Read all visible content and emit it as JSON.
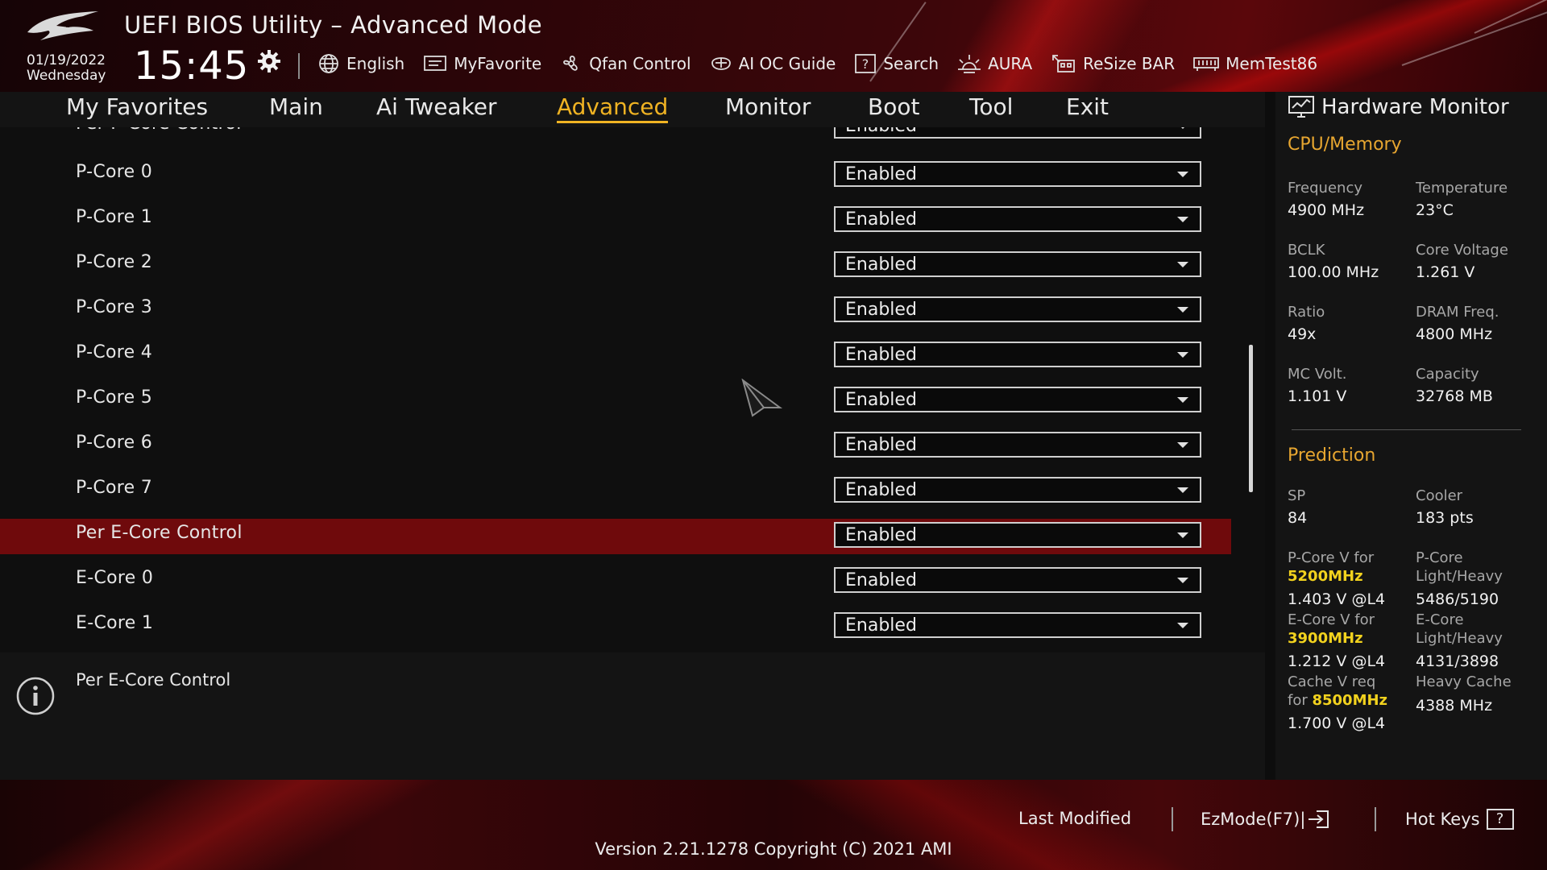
{
  "header": {
    "title": "UEFI BIOS Utility – Advanced Mode",
    "date": "01/19/2022",
    "weekday": "Wednesday",
    "time": "15:45",
    "toolbar": [
      {
        "label": "English",
        "icon": "globe-icon"
      },
      {
        "label": "MyFavorite",
        "icon": "favorite-icon"
      },
      {
        "label": "Qfan Control",
        "icon": "fan-icon"
      },
      {
        "label": "AI OC Guide",
        "icon": "ai-oc-icon"
      },
      {
        "label": "Search",
        "icon": "search-icon"
      },
      {
        "label": "AURA",
        "icon": "aura-icon"
      },
      {
        "label": "ReSize BAR",
        "icon": "resize-bar-icon"
      },
      {
        "label": "MemTest86",
        "icon": "memtest-icon"
      }
    ]
  },
  "tabs": [
    {
      "label": "My Favorites",
      "active": false
    },
    {
      "label": "Main",
      "active": false
    },
    {
      "label": "Ai Tweaker",
      "active": false
    },
    {
      "label": "Advanced",
      "active": true
    },
    {
      "label": "Monitor",
      "active": false
    },
    {
      "label": "Boot",
      "active": false
    },
    {
      "label": "Tool",
      "active": false
    },
    {
      "label": "Exit",
      "active": false
    }
  ],
  "settings": [
    {
      "label": "Per P-Core Control",
      "value": "Enabled",
      "selected": false
    },
    {
      "label": "P-Core 0",
      "value": "Enabled",
      "selected": false
    },
    {
      "label": "P-Core 1",
      "value": "Enabled",
      "selected": false
    },
    {
      "label": "P-Core 2",
      "value": "Enabled",
      "selected": false
    },
    {
      "label": "P-Core 3",
      "value": "Enabled",
      "selected": false
    },
    {
      "label": "P-Core 4",
      "value": "Enabled",
      "selected": false
    },
    {
      "label": "P-Core 5",
      "value": "Enabled",
      "selected": false
    },
    {
      "label": "P-Core 6",
      "value": "Enabled",
      "selected": false
    },
    {
      "label": "P-Core 7",
      "value": "Enabled",
      "selected": false
    },
    {
      "label": "Per E-Core Control",
      "value": "Enabled",
      "selected": true
    },
    {
      "label": "E-Core 0",
      "value": "Enabled",
      "selected": false
    },
    {
      "label": "E-Core 1",
      "value": "Enabled",
      "selected": false
    }
  ],
  "help": {
    "text": "Per E-Core Control"
  },
  "hardware_monitor": {
    "title": "Hardware Monitor",
    "cpu_memory": {
      "section": "CPU/Memory",
      "items": [
        {
          "label": "Frequency",
          "value": "4900 MHz"
        },
        {
          "label": "Temperature",
          "value": "23°C"
        },
        {
          "label": "BCLK",
          "value": "100.00 MHz"
        },
        {
          "label": "Core Voltage",
          "value": "1.261 V"
        },
        {
          "label": "Ratio",
          "value": "49x"
        },
        {
          "label": "DRAM Freq.",
          "value": "4800 MHz"
        },
        {
          "label": "MC Volt.",
          "value": "1.101 V"
        },
        {
          "label": "Capacity",
          "value": "32768 MB"
        }
      ]
    },
    "prediction": {
      "section": "Prediction",
      "sp_label": "SP",
      "sp_value": "84",
      "cooler_label": "Cooler",
      "cooler_value": "183 pts",
      "pcore_v_label": "P-Core V for",
      "pcore_v_freq": "5200MHz",
      "pcore_v_value": "1.403 V @L4",
      "pcore_lh_label1": "P-Core",
      "pcore_lh_label2": "Light/Heavy",
      "pcore_lh_value": "5486/5190",
      "ecore_v_label": "E-Core V for",
      "ecore_v_freq": "3900MHz",
      "ecore_v_value": "1.212 V @L4",
      "ecore_lh_label1": "E-Core",
      "ecore_lh_label2": "Light/Heavy",
      "ecore_lh_value": "4131/3898",
      "cache_v_label1": "Cache V req",
      "cache_v_label2": "for",
      "cache_v_freq": "8500MHz",
      "cache_v_value": "1.700 V @L4",
      "heavy_cache_label": "Heavy Cache",
      "heavy_cache_value": "4388 MHz"
    }
  },
  "footer": {
    "last_modified": "Last Modified",
    "ezmode": "EzMode(F7)|",
    "hot_keys": "Hot Keys",
    "hot_keys_glyph": "?",
    "version": "Version 2.21.1278 Copyright (C) 2021 AMI"
  },
  "colors": {
    "accent": "#f0b323",
    "selected_row": "#6f0a0c",
    "highlight": "#f2d21e",
    "section_heading": "#e7a630"
  }
}
